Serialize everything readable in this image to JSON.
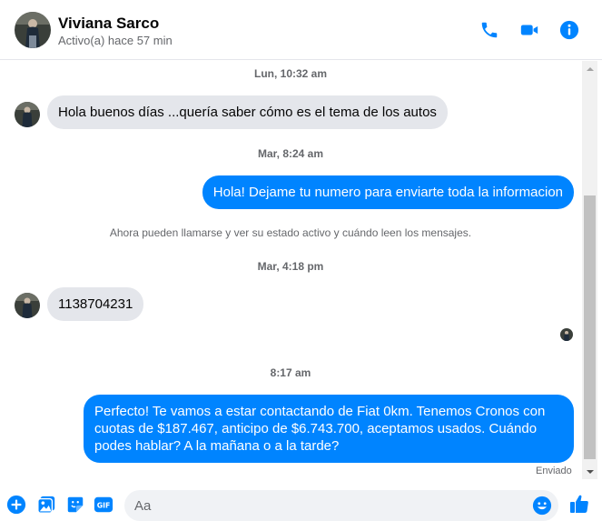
{
  "header": {
    "name": "Viviana Sarco",
    "status": "Activo(a) hace 57 min",
    "accent": "#0084ff"
  },
  "thread": {
    "timestamps": {
      "t1": "Lun, 10:32 am",
      "t2": "Mar, 8:24 am",
      "t3": "Mar, 4:18 pm",
      "t4": "8:17 am"
    },
    "messages": {
      "m1": "Hola buenos días ...quería saber cómo es el tema de los autos",
      "m2": "Hola! Dejame tu numero para enviarte toda la informacion",
      "m3": "1138704231",
      "m4": "Perfecto! Te vamos a estar contactando de Fiat 0km. Tenemos Cronos con cuotas de $187.467, anticipo de $6.743.700, aceptamos usados. Cuándo podes hablar? A la mañana o a la tarde?"
    },
    "notice": "Ahora pueden llamarse y ver su estado activo y cuándo leen los mensajes.",
    "delivery_status": "Enviado"
  },
  "composer": {
    "placeholder": "Aa"
  },
  "icons": {
    "call": "phone-icon",
    "video": "video-icon",
    "info": "info-icon",
    "plus": "plus-icon",
    "gallery": "gallery-icon",
    "sticker": "sticker-icon",
    "gif": "gif-icon",
    "emoji": "emoji-icon",
    "like": "thumbs-up-icon"
  }
}
